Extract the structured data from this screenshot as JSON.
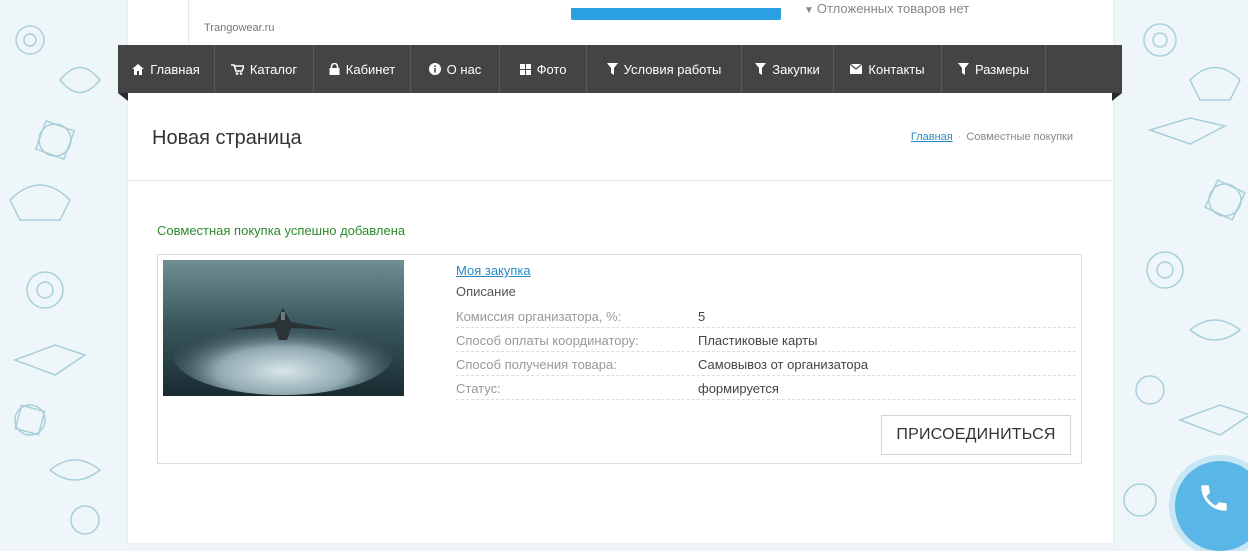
{
  "header": {
    "site_link": "Trangowear.ru",
    "deferred_status": "Отложенных товаров нет"
  },
  "nav": {
    "items": [
      {
        "label": "Главная",
        "icon": "home-icon"
      },
      {
        "label": "Каталог",
        "icon": "cart-icon"
      },
      {
        "label": "Кабинет",
        "icon": "lock-icon"
      },
      {
        "label": "О нас",
        "icon": "info-icon"
      },
      {
        "label": "Фото",
        "icon": "grid-icon"
      },
      {
        "label": "Условия работы",
        "icon": "filter-icon"
      },
      {
        "label": "Закупки",
        "icon": "filter-icon"
      },
      {
        "label": "Контакты",
        "icon": "envelope-icon"
      },
      {
        "label": "Размеры",
        "icon": "filter-icon"
      }
    ]
  },
  "page": {
    "title": "Новая страница",
    "breadcrumb": {
      "home": "Главная",
      "current": "Совместные покупки"
    }
  },
  "notice": {
    "success": "Совместная покупка успешно добавлена"
  },
  "purchase": {
    "title": "Моя закупка",
    "description": "Описание",
    "props": [
      {
        "key": "Комиссия организатора, %:",
        "value": "5"
      },
      {
        "key": "Способ оплаты координатору:",
        "value": "Пластиковые карты"
      },
      {
        "key": "Способ получения товара:",
        "value": "Самовывоз от организатора"
      },
      {
        "key": "Статус:",
        "value": "формируется"
      }
    ],
    "join_label": "ПРИСОЕДИНИТЬСЯ"
  },
  "colors": {
    "nav_bg": "#444444",
    "accent": "#2a9fe2",
    "link": "#2a8bc4",
    "success": "#2e8b2e",
    "call_button": "#59b6e6"
  }
}
